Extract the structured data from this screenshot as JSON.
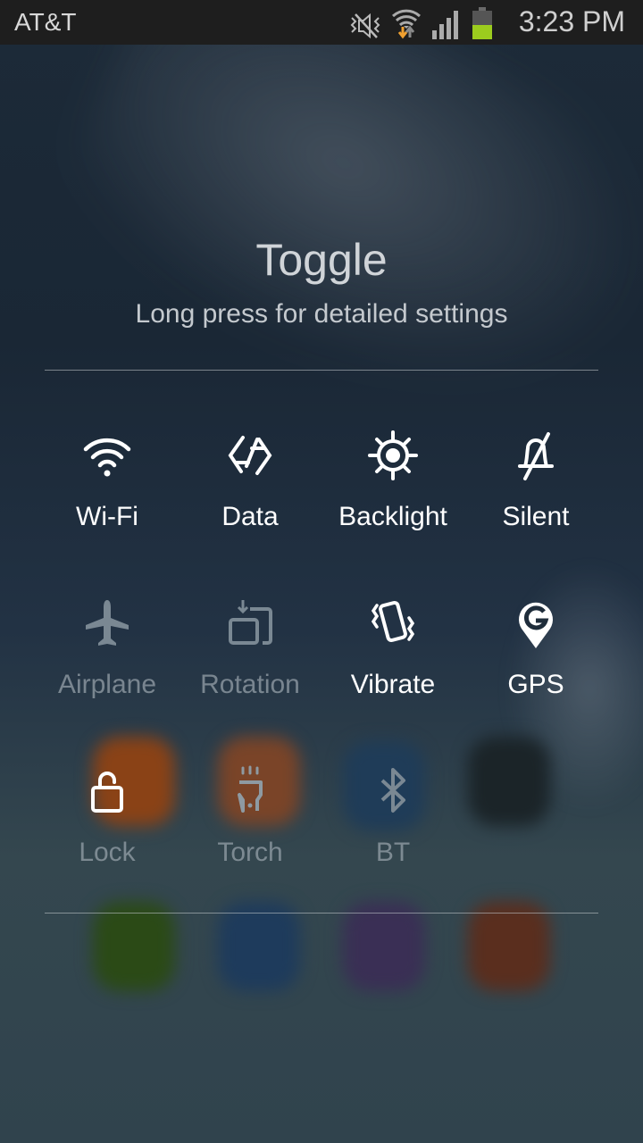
{
  "status_bar": {
    "carrier": "AT&T",
    "time": "3:23 PM",
    "icons": [
      "mute-vibrate-icon",
      "wifi-data-activity-icon",
      "signal-strength-icon",
      "battery-icon"
    ],
    "battery_color": "#9ccc1e"
  },
  "panel": {
    "title": "Toggle",
    "subtitle": "Long press for detailed settings"
  },
  "toggles": [
    {
      "label": "Wi-Fi",
      "icon": "wifi-icon",
      "state": "on"
    },
    {
      "label": "Data",
      "icon": "data-sync-icon",
      "state": "on"
    },
    {
      "label": "Backlight",
      "icon": "brightness-icon",
      "state": "on"
    },
    {
      "label": "Silent",
      "icon": "bell-off-icon",
      "state": "on"
    },
    {
      "label": "Airplane",
      "icon": "airplane-icon",
      "state": "off"
    },
    {
      "label": "Rotation",
      "icon": "rotation-icon",
      "state": "off"
    },
    {
      "label": "Vibrate",
      "icon": "vibrate-icon",
      "state": "on"
    },
    {
      "label": "GPS",
      "icon": "gps-icon",
      "state": "on"
    },
    {
      "label": "Lock",
      "icon": "unlock-icon",
      "state": "on-icon-only"
    },
    {
      "label": "Torch",
      "icon": "torch-icon",
      "state": "off"
    },
    {
      "label": "BT",
      "icon": "bluetooth-icon",
      "state": "off"
    }
  ]
}
